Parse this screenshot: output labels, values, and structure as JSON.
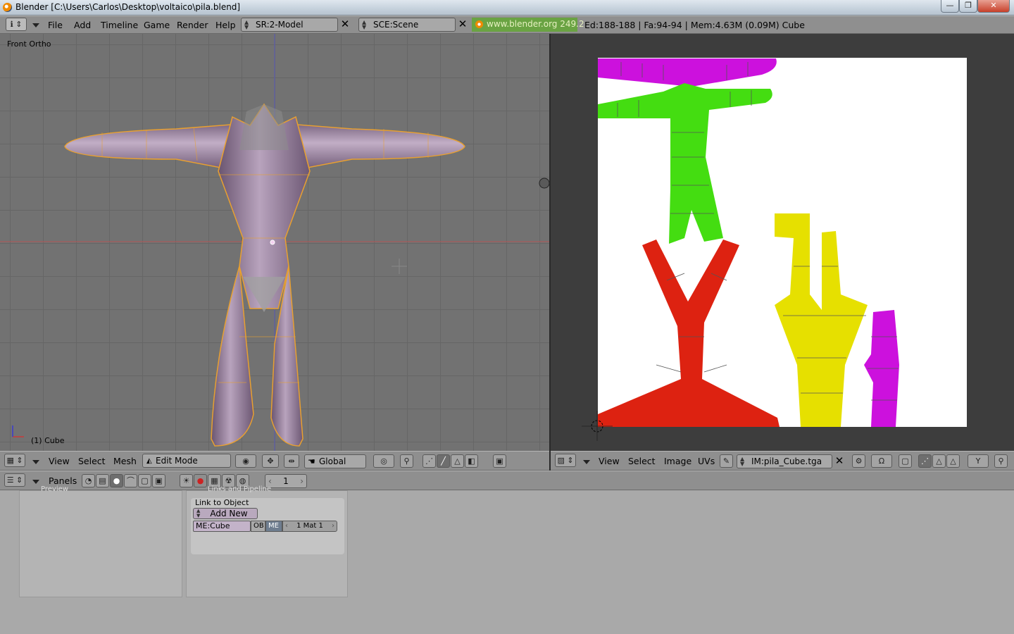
{
  "window": {
    "title": "Blender [C:\\Users\\Carlos\\Desktop\\voltaico\\pila.blend]",
    "controls": [
      "—",
      "❐",
      "✕"
    ]
  },
  "top_header": {
    "menus": [
      "File",
      "Add",
      "Timeline",
      "Game",
      "Render",
      "Help"
    ],
    "screen_field": "SR:2-Model",
    "scene_field": "SCE:Scene",
    "website": "www.blender.org 249.2",
    "stats": "Ed:188-188 | Fa:94-94 | Mem:4.63M (0.09M) Cube"
  },
  "viewport3d": {
    "view_label": "Front Ortho",
    "object_label": "(1) Cube",
    "menus": [
      "View",
      "Select",
      "Mesh"
    ],
    "mode": "Edit Mode",
    "orientation": "Global"
  },
  "uv_editor": {
    "menus": [
      "View",
      "Select",
      "Image",
      "UVs"
    ],
    "image_field": "IM:pila_Cube.tga"
  },
  "buttons_window": {
    "menu": "Panels",
    "frame": "1",
    "panel_left_title": "Preview",
    "panel_right_title": "Links and Pipeline",
    "link_label": "Link to Object",
    "add_new": "Add New",
    "mesh_name": "ME:Cube",
    "ob_btn": "OB",
    "me_btn": "ME",
    "mat_nav": "1 Mat 1"
  },
  "colors": {
    "mesh": "#a58ea8",
    "selection": "#e8a030",
    "uv_magenta": "#cc11dd",
    "uv_green": "#44dd11",
    "uv_red": "#dd2211",
    "uv_yellow": "#e6e000",
    "website_bg": "#6aa343"
  }
}
